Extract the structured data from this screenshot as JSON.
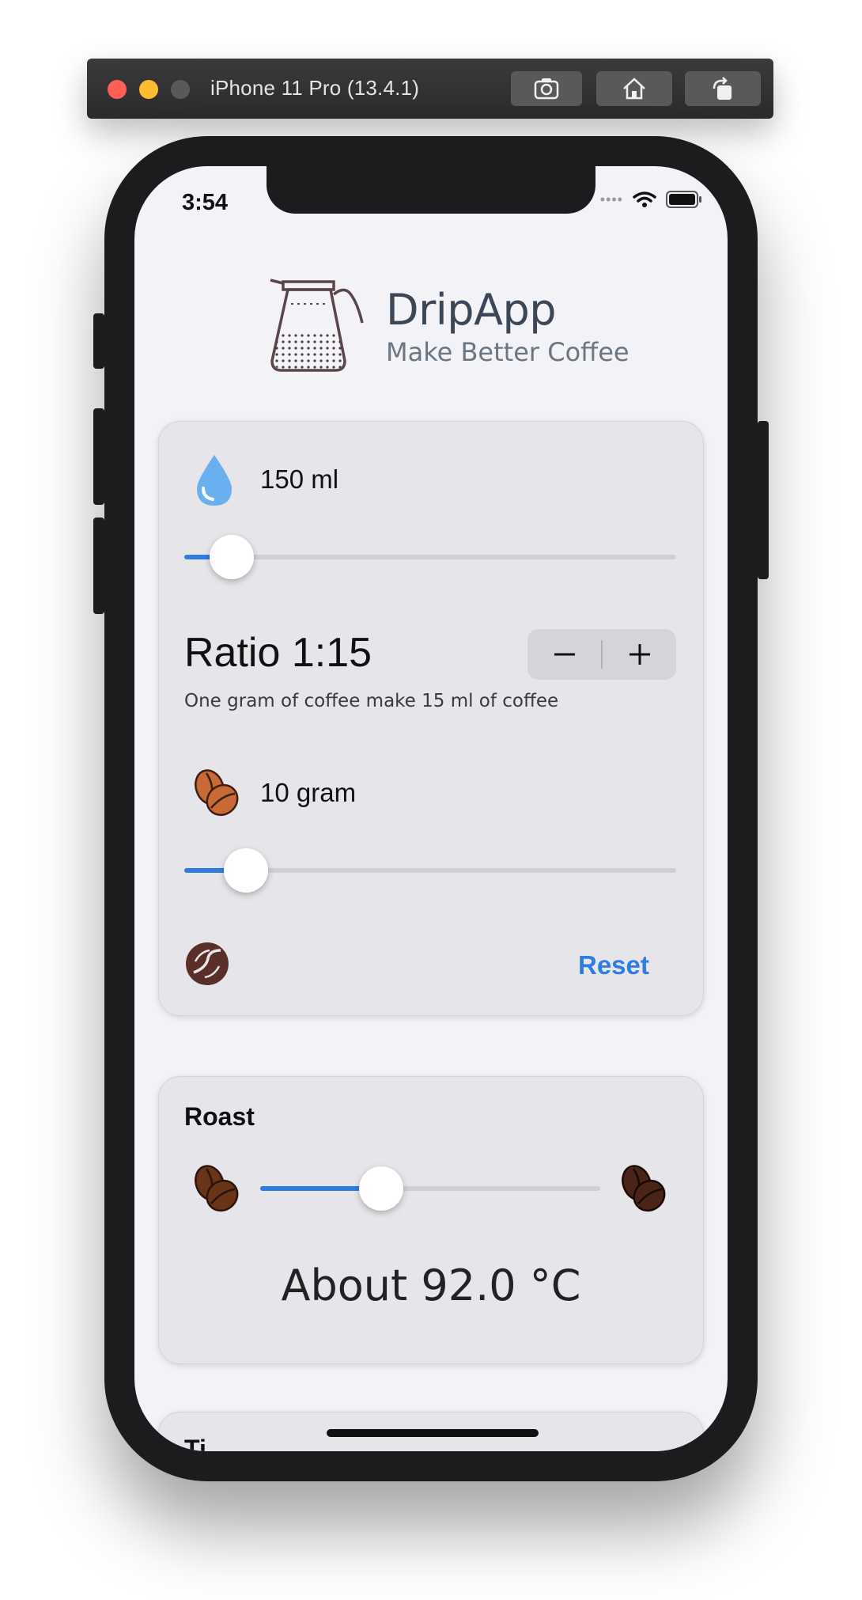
{
  "simulator": {
    "title": "iPhone 11 Pro (13.4.1)",
    "buttons": [
      "screenshot-icon",
      "home-icon",
      "rotate-icon"
    ]
  },
  "status_bar": {
    "time": "3:54",
    "cellular_indicator": "••••"
  },
  "header": {
    "title": "DripApp",
    "subtitle": "Make Better Coffee",
    "logo": "coffee-pot-icon"
  },
  "brew_card": {
    "water_label": "150 ml",
    "water_slider_value": 0.1,
    "ratio_title": "Ratio 1:15",
    "ratio_minus": "−",
    "ratio_plus": "+",
    "ratio_description": "One gram of coffee make 15 ml of coffee",
    "coffee_label": "10 gram",
    "coffee_slider_value": 0.13,
    "reset_label": "Reset"
  },
  "roast_card": {
    "title": "Roast",
    "roast_slider_value": 0.36,
    "temperature": "About 92.0 °C"
  },
  "next_card": {
    "title": "Ti"
  },
  "colors": {
    "accent": "#2f7de1",
    "background": "#f2f2f7",
    "card": "#e5e5ea",
    "water_drop": "#6ab0f0",
    "light_bean": "#c86a35",
    "dark_bean": "#4a2418"
  }
}
